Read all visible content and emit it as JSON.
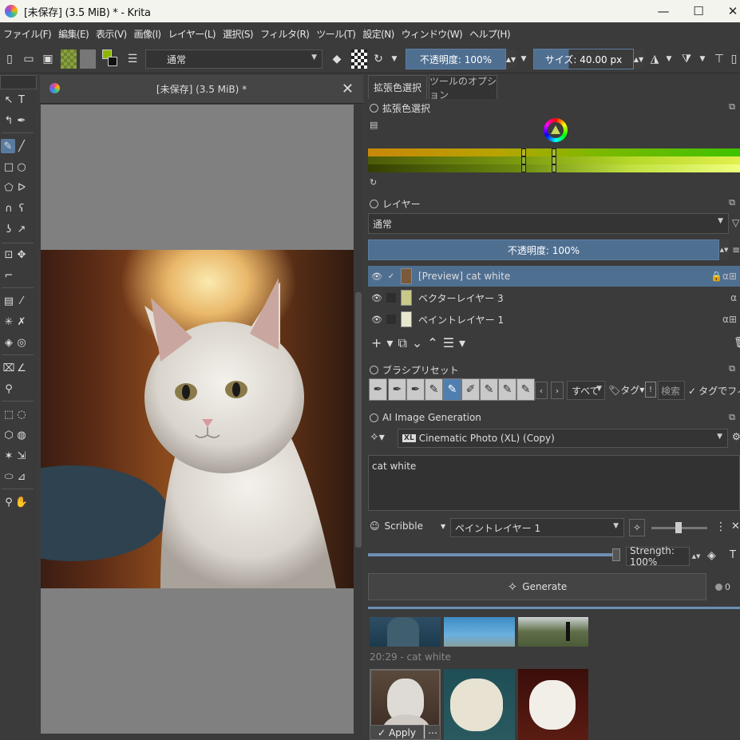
{
  "window": {
    "title": "[未保存]  (3.5 MiB) * - Krita",
    "minimize": "—",
    "maximize": "☐",
    "close": "✕"
  },
  "menu": [
    "ファイル(F)",
    "編集(E)",
    "表示(V)",
    "画像(I)",
    "レイヤー(L)",
    "選択(S)",
    "フィルタ(R)",
    "ツール(T)",
    "設定(N)",
    "ウィンドウ(W)",
    "ヘルプ(H)"
  ],
  "toolbar": {
    "blend_mode": "通常",
    "opacity": "不透明度: 100%",
    "size": "サイズ: 40.00 px",
    "fg_color": "#8db600",
    "bg_color": "#111111"
  },
  "canvas": {
    "tab_title": "[未保存]  (3.5 MiB) *"
  },
  "dock": {
    "tabs": [
      "拡張色選択",
      "ツールのオプション"
    ],
    "color_selector": {
      "title": "拡張色選択"
    },
    "layers": {
      "title": "レイヤー",
      "blend_mode": "通常",
      "opacity": "不透明度:  100%",
      "items": [
        {
          "name": "[Preview] cat white",
          "selected": true
        },
        {
          "name": "ベクターレイヤー 3",
          "selected": false
        },
        {
          "name": "ペイントレイヤー 1",
          "selected": false
        }
      ]
    },
    "brush_presets": {
      "title": "ブラシプリセット",
      "filter": "すべて",
      "tag": "タグ",
      "search": "検索",
      "filter_by_tag": "タグでフィル"
    },
    "ai": {
      "title": "AI Image Generation",
      "style": "Cinematic Photo (XL) (Copy)",
      "style_badge": "XL",
      "prompt": "cat white",
      "mode": "Scribble",
      "control_layer": "ペイントレイヤー 1",
      "strength": "Strength: 100%",
      "generate": "Generate",
      "queue_count": "0",
      "history_label": "20:29 - cat white",
      "apply": "Apply",
      "more": "⋯"
    }
  }
}
